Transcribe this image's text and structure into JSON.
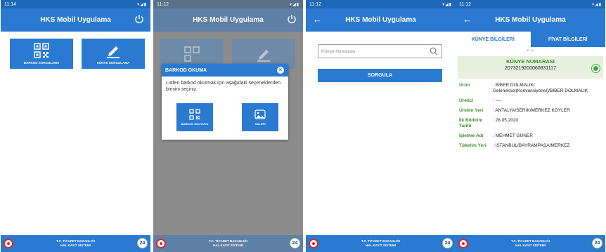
{
  "common": {
    "app_title": "HKS Mobil Uygulama",
    "footer_line1": "T.C. TİCARET BAKANLIĞI",
    "footer_line2": "HAL KAYIT SİSTEMİ",
    "footer_badge": "24",
    "accent_color": "#2a7ad2"
  },
  "screen1": {
    "time": "11:14",
    "tiles": [
      {
        "label": "BARKOD SORGULAMA",
        "icon": "qr-code-icon"
      },
      {
        "label": "KÜNYE SORGULAMA",
        "icon": "pencil-icon"
      }
    ]
  },
  "screen2": {
    "time": "11:12",
    "dialog": {
      "title": "BARKOD OKUMA",
      "message": "Lütfen barkod okutmak için aşağıdaki seçeneklerden birisini seçiniz.",
      "buttons": [
        {
          "label": "BARKOD OKUYUCU",
          "icon": "barcode-scanner-icon"
        },
        {
          "label": "GALERİ",
          "icon": "gallery-icon"
        }
      ]
    }
  },
  "screen3": {
    "time": "11:12",
    "search_placeholder": "Künye Numarası",
    "button": "SORGULA"
  },
  "screen4": {
    "time": "11:12",
    "tabs": [
      "KÜNYE BİLGİLERİ",
      "FİYAT BİLGİLERİ"
    ],
    "kunye_header": "KÜNYE NUMARASI",
    "kunye_number": "2073219200060831117",
    "fields": [
      {
        "label": "Ürün",
        "value": "BİBER DOLMALIK/ Geleneksel(Konvansiyonel)/BİBER DOLMALIK"
      },
      {
        "label": "Üretici",
        "value": "----"
      },
      {
        "label": "Üretim Yeri",
        "value": "ANTALYA/SERİK/MERKEZ KÖYLER"
      },
      {
        "label": "İlk Bildirim Tarihi",
        "value": "28.05.2020"
      },
      {
        "label": "İşletme Adı",
        "value": "MEHMET GÜNER"
      },
      {
        "label": "Tüketim Yeri",
        "value": "İSTANBUL/BAYRAMPAŞA/MERKEZ"
      }
    ]
  }
}
